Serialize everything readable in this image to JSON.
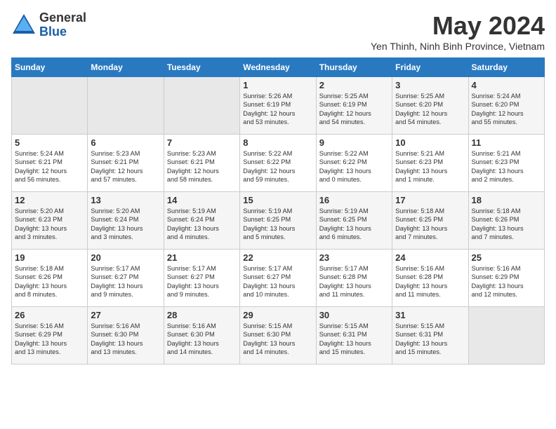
{
  "header": {
    "logo_general": "General",
    "logo_blue": "Blue",
    "month_year": "May 2024",
    "location": "Yen Thinh, Ninh Binh Province, Vietnam"
  },
  "days_of_week": [
    "Sunday",
    "Monday",
    "Tuesday",
    "Wednesday",
    "Thursday",
    "Friday",
    "Saturday"
  ],
  "weeks": [
    [
      {
        "day": "",
        "content": ""
      },
      {
        "day": "",
        "content": ""
      },
      {
        "day": "",
        "content": ""
      },
      {
        "day": "1",
        "content": "Sunrise: 5:26 AM\nSunset: 6:19 PM\nDaylight: 12 hours\nand 53 minutes."
      },
      {
        "day": "2",
        "content": "Sunrise: 5:25 AM\nSunset: 6:19 PM\nDaylight: 12 hours\nand 54 minutes."
      },
      {
        "day": "3",
        "content": "Sunrise: 5:25 AM\nSunset: 6:20 PM\nDaylight: 12 hours\nand 54 minutes."
      },
      {
        "day": "4",
        "content": "Sunrise: 5:24 AM\nSunset: 6:20 PM\nDaylight: 12 hours\nand 55 minutes."
      }
    ],
    [
      {
        "day": "5",
        "content": "Sunrise: 5:24 AM\nSunset: 6:21 PM\nDaylight: 12 hours\nand 56 minutes."
      },
      {
        "day": "6",
        "content": "Sunrise: 5:23 AM\nSunset: 6:21 PM\nDaylight: 12 hours\nand 57 minutes."
      },
      {
        "day": "7",
        "content": "Sunrise: 5:23 AM\nSunset: 6:21 PM\nDaylight: 12 hours\nand 58 minutes."
      },
      {
        "day": "8",
        "content": "Sunrise: 5:22 AM\nSunset: 6:22 PM\nDaylight: 12 hours\nand 59 minutes."
      },
      {
        "day": "9",
        "content": "Sunrise: 5:22 AM\nSunset: 6:22 PM\nDaylight: 13 hours\nand 0 minutes."
      },
      {
        "day": "10",
        "content": "Sunrise: 5:21 AM\nSunset: 6:23 PM\nDaylight: 13 hours\nand 1 minute."
      },
      {
        "day": "11",
        "content": "Sunrise: 5:21 AM\nSunset: 6:23 PM\nDaylight: 13 hours\nand 2 minutes."
      }
    ],
    [
      {
        "day": "12",
        "content": "Sunrise: 5:20 AM\nSunset: 6:23 PM\nDaylight: 13 hours\nand 3 minutes."
      },
      {
        "day": "13",
        "content": "Sunrise: 5:20 AM\nSunset: 6:24 PM\nDaylight: 13 hours\nand 3 minutes."
      },
      {
        "day": "14",
        "content": "Sunrise: 5:19 AM\nSunset: 6:24 PM\nDaylight: 13 hours\nand 4 minutes."
      },
      {
        "day": "15",
        "content": "Sunrise: 5:19 AM\nSunset: 6:25 PM\nDaylight: 13 hours\nand 5 minutes."
      },
      {
        "day": "16",
        "content": "Sunrise: 5:19 AM\nSunset: 6:25 PM\nDaylight: 13 hours\nand 6 minutes."
      },
      {
        "day": "17",
        "content": "Sunrise: 5:18 AM\nSunset: 6:25 PM\nDaylight: 13 hours\nand 7 minutes."
      },
      {
        "day": "18",
        "content": "Sunrise: 5:18 AM\nSunset: 6:26 PM\nDaylight: 13 hours\nand 7 minutes."
      }
    ],
    [
      {
        "day": "19",
        "content": "Sunrise: 5:18 AM\nSunset: 6:26 PM\nDaylight: 13 hours\nand 8 minutes."
      },
      {
        "day": "20",
        "content": "Sunrise: 5:17 AM\nSunset: 6:27 PM\nDaylight: 13 hours\nand 9 minutes."
      },
      {
        "day": "21",
        "content": "Sunrise: 5:17 AM\nSunset: 6:27 PM\nDaylight: 13 hours\nand 9 minutes."
      },
      {
        "day": "22",
        "content": "Sunrise: 5:17 AM\nSunset: 6:27 PM\nDaylight: 13 hours\nand 10 minutes."
      },
      {
        "day": "23",
        "content": "Sunrise: 5:17 AM\nSunset: 6:28 PM\nDaylight: 13 hours\nand 11 minutes."
      },
      {
        "day": "24",
        "content": "Sunrise: 5:16 AM\nSunset: 6:28 PM\nDaylight: 13 hours\nand 11 minutes."
      },
      {
        "day": "25",
        "content": "Sunrise: 5:16 AM\nSunset: 6:29 PM\nDaylight: 13 hours\nand 12 minutes."
      }
    ],
    [
      {
        "day": "26",
        "content": "Sunrise: 5:16 AM\nSunset: 6:29 PM\nDaylight: 13 hours\nand 13 minutes."
      },
      {
        "day": "27",
        "content": "Sunrise: 5:16 AM\nSunset: 6:30 PM\nDaylight: 13 hours\nand 13 minutes."
      },
      {
        "day": "28",
        "content": "Sunrise: 5:16 AM\nSunset: 6:30 PM\nDaylight: 13 hours\nand 14 minutes."
      },
      {
        "day": "29",
        "content": "Sunrise: 5:15 AM\nSunset: 6:30 PM\nDaylight: 13 hours\nand 14 minutes."
      },
      {
        "day": "30",
        "content": "Sunrise: 5:15 AM\nSunset: 6:31 PM\nDaylight: 13 hours\nand 15 minutes."
      },
      {
        "day": "31",
        "content": "Sunrise: 5:15 AM\nSunset: 6:31 PM\nDaylight: 13 hours\nand 15 minutes."
      },
      {
        "day": "",
        "content": ""
      }
    ]
  ]
}
